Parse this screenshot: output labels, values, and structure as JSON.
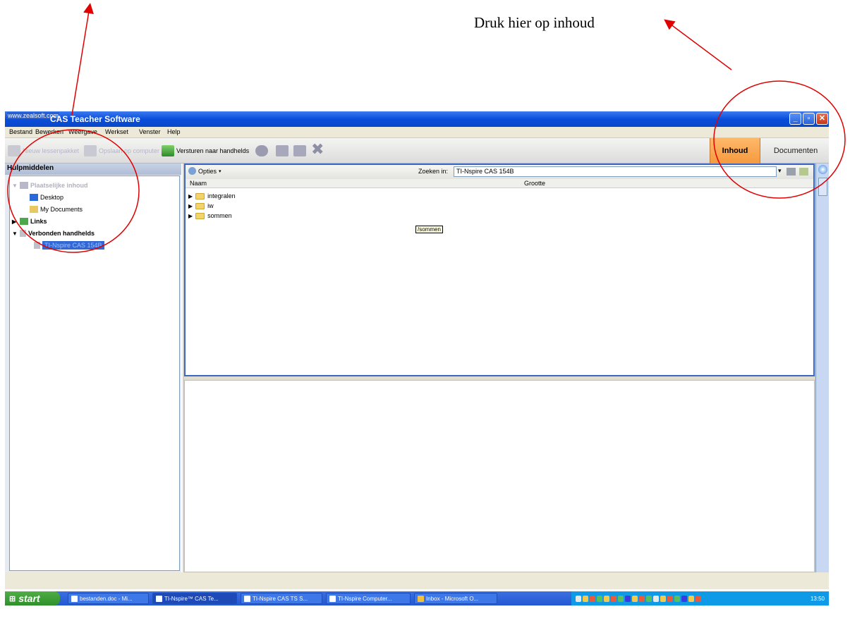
{
  "annotation": {
    "text": "Druk hier op inhoud"
  },
  "window": {
    "logo_text": "www.zealsoft.com",
    "title": "TI-Nspire CAS Teacher Software",
    "title_visible": "CAS Teacher Software"
  },
  "menubar": {
    "items": [
      "Bestand",
      "Bewerken",
      "Weergave",
      "Werkset",
      "Venster",
      "Help"
    ]
  },
  "toolbar": {
    "new_pack_label": "Nieuw lessenpakket",
    "save_to_computer_label": "Opslaan op computer",
    "send_label": "Versturen naar handhelds",
    "tab_inhoud": "Inhoud",
    "tab_documenten": "Documenten"
  },
  "left_panel": {
    "header": "Hulpmiddelen",
    "tree": {
      "local_content": "Plaatselijke inhoud",
      "desktop": "Desktop",
      "my_documents": "My Documents",
      "links": "Links",
      "connected": "Verbonden handhelds",
      "device": "TI-Nspire CAS 154B"
    }
  },
  "file_browser": {
    "options_label": "Opties",
    "search_label": "Zoeken in:",
    "search_value": "TI-Nspire CAS 154B",
    "col_name": "Naam",
    "col_size": "Grootte",
    "folders": [
      "integralen",
      "iw",
      "sommen"
    ],
    "tooltip": "/sommen"
  },
  "taskbar": {
    "start_label": "start",
    "tasks": [
      "bestanden.doc - Mi...",
      "TI-Nspire™ CAS Te...",
      "TI-Nspire CAS TS S...",
      "TI-Nspire Computer...",
      "Inbox - Microsoft O..."
    ],
    "clock": "13:50"
  },
  "colors": {
    "accent_orange": "#f59a3e",
    "titlebar_blue": "#0a4ddb",
    "annotation_red": "#e00000"
  }
}
